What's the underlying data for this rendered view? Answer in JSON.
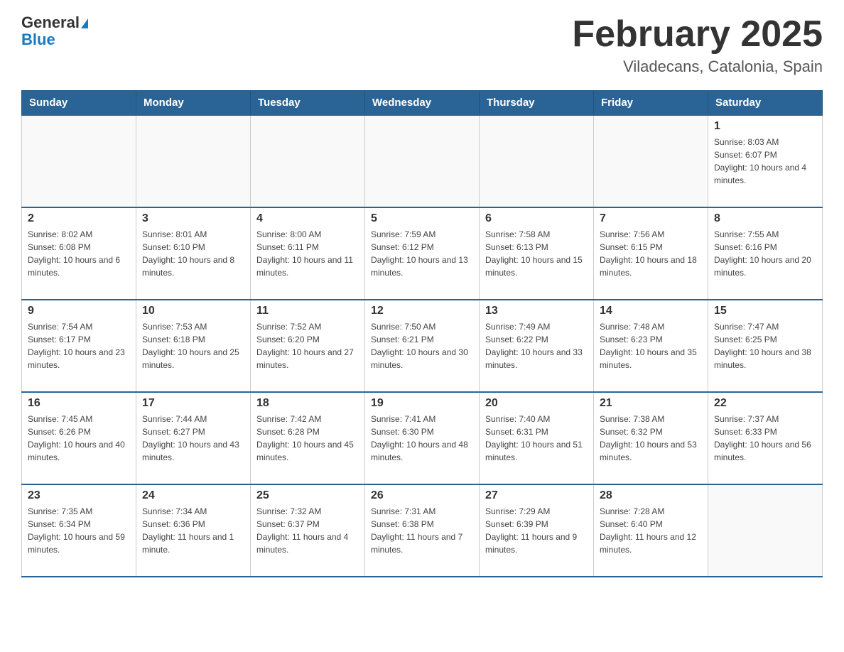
{
  "header": {
    "logo_general": "General",
    "logo_blue": "Blue",
    "month_title": "February 2025",
    "location": "Viladecans, Catalonia, Spain"
  },
  "weekdays": [
    "Sunday",
    "Monday",
    "Tuesday",
    "Wednesday",
    "Thursday",
    "Friday",
    "Saturday"
  ],
  "weeks": [
    [
      {
        "day": "",
        "info": ""
      },
      {
        "day": "",
        "info": ""
      },
      {
        "day": "",
        "info": ""
      },
      {
        "day": "",
        "info": ""
      },
      {
        "day": "",
        "info": ""
      },
      {
        "day": "",
        "info": ""
      },
      {
        "day": "1",
        "info": "Sunrise: 8:03 AM\nSunset: 6:07 PM\nDaylight: 10 hours and 4 minutes."
      }
    ],
    [
      {
        "day": "2",
        "info": "Sunrise: 8:02 AM\nSunset: 6:08 PM\nDaylight: 10 hours and 6 minutes."
      },
      {
        "day": "3",
        "info": "Sunrise: 8:01 AM\nSunset: 6:10 PM\nDaylight: 10 hours and 8 minutes."
      },
      {
        "day": "4",
        "info": "Sunrise: 8:00 AM\nSunset: 6:11 PM\nDaylight: 10 hours and 11 minutes."
      },
      {
        "day": "5",
        "info": "Sunrise: 7:59 AM\nSunset: 6:12 PM\nDaylight: 10 hours and 13 minutes."
      },
      {
        "day": "6",
        "info": "Sunrise: 7:58 AM\nSunset: 6:13 PM\nDaylight: 10 hours and 15 minutes."
      },
      {
        "day": "7",
        "info": "Sunrise: 7:56 AM\nSunset: 6:15 PM\nDaylight: 10 hours and 18 minutes."
      },
      {
        "day": "8",
        "info": "Sunrise: 7:55 AM\nSunset: 6:16 PM\nDaylight: 10 hours and 20 minutes."
      }
    ],
    [
      {
        "day": "9",
        "info": "Sunrise: 7:54 AM\nSunset: 6:17 PM\nDaylight: 10 hours and 23 minutes."
      },
      {
        "day": "10",
        "info": "Sunrise: 7:53 AM\nSunset: 6:18 PM\nDaylight: 10 hours and 25 minutes."
      },
      {
        "day": "11",
        "info": "Sunrise: 7:52 AM\nSunset: 6:20 PM\nDaylight: 10 hours and 27 minutes."
      },
      {
        "day": "12",
        "info": "Sunrise: 7:50 AM\nSunset: 6:21 PM\nDaylight: 10 hours and 30 minutes."
      },
      {
        "day": "13",
        "info": "Sunrise: 7:49 AM\nSunset: 6:22 PM\nDaylight: 10 hours and 33 minutes."
      },
      {
        "day": "14",
        "info": "Sunrise: 7:48 AM\nSunset: 6:23 PM\nDaylight: 10 hours and 35 minutes."
      },
      {
        "day": "15",
        "info": "Sunrise: 7:47 AM\nSunset: 6:25 PM\nDaylight: 10 hours and 38 minutes."
      }
    ],
    [
      {
        "day": "16",
        "info": "Sunrise: 7:45 AM\nSunset: 6:26 PM\nDaylight: 10 hours and 40 minutes."
      },
      {
        "day": "17",
        "info": "Sunrise: 7:44 AM\nSunset: 6:27 PM\nDaylight: 10 hours and 43 minutes."
      },
      {
        "day": "18",
        "info": "Sunrise: 7:42 AM\nSunset: 6:28 PM\nDaylight: 10 hours and 45 minutes."
      },
      {
        "day": "19",
        "info": "Sunrise: 7:41 AM\nSunset: 6:30 PM\nDaylight: 10 hours and 48 minutes."
      },
      {
        "day": "20",
        "info": "Sunrise: 7:40 AM\nSunset: 6:31 PM\nDaylight: 10 hours and 51 minutes."
      },
      {
        "day": "21",
        "info": "Sunrise: 7:38 AM\nSunset: 6:32 PM\nDaylight: 10 hours and 53 minutes."
      },
      {
        "day": "22",
        "info": "Sunrise: 7:37 AM\nSunset: 6:33 PM\nDaylight: 10 hours and 56 minutes."
      }
    ],
    [
      {
        "day": "23",
        "info": "Sunrise: 7:35 AM\nSunset: 6:34 PM\nDaylight: 10 hours and 59 minutes."
      },
      {
        "day": "24",
        "info": "Sunrise: 7:34 AM\nSunset: 6:36 PM\nDaylight: 11 hours and 1 minute."
      },
      {
        "day": "25",
        "info": "Sunrise: 7:32 AM\nSunset: 6:37 PM\nDaylight: 11 hours and 4 minutes."
      },
      {
        "day": "26",
        "info": "Sunrise: 7:31 AM\nSunset: 6:38 PM\nDaylight: 11 hours and 7 minutes."
      },
      {
        "day": "27",
        "info": "Sunrise: 7:29 AM\nSunset: 6:39 PM\nDaylight: 11 hours and 9 minutes."
      },
      {
        "day": "28",
        "info": "Sunrise: 7:28 AM\nSunset: 6:40 PM\nDaylight: 11 hours and 12 minutes."
      },
      {
        "day": "",
        "info": ""
      }
    ]
  ]
}
